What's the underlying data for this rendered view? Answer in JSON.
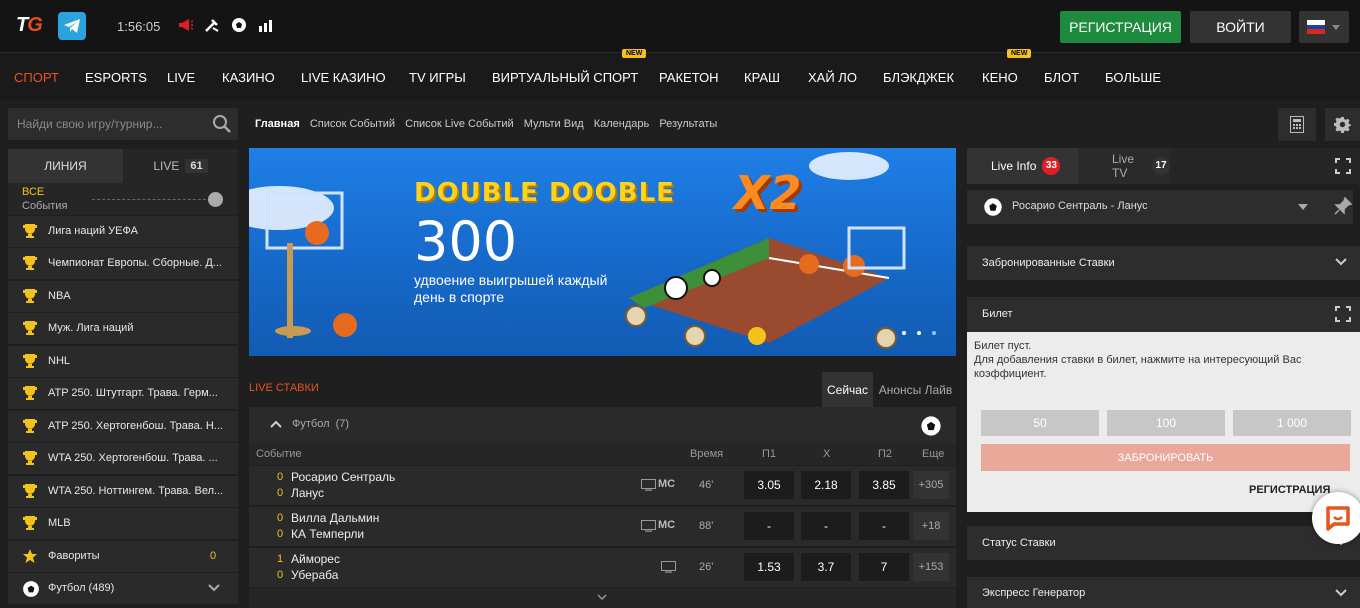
{
  "header": {
    "logo_t": "T",
    "logo_g": "G",
    "clock": "1:56:05",
    "register_label": "РЕГИСТРАЦИЯ",
    "login_label": "ВОЙТИ",
    "language": "ru"
  },
  "nav": {
    "items": [
      "СПОРТ",
      "ESPORTS",
      "LIVE",
      "КАЗИНО",
      "LIVE КАЗИНО",
      "TV ИГРЫ",
      "ВИРТУАЛЬНЫЙ СПОРТ",
      "РАКЕТОН",
      "КРАШ",
      "ХАЙ ЛО",
      "БЛЭКДЖЕК",
      "КЕНО",
      "БЛОТ",
      "БОЛЬШЕ"
    ],
    "new_badge": "NEW"
  },
  "search": {
    "placeholder": "Найди свою игру/турнир..."
  },
  "left_tabs": {
    "line": "ЛИНИЯ",
    "live": "LIVE",
    "live_count": "61"
  },
  "filter": {
    "all": "ВСЕ",
    "events": "События"
  },
  "left_list": [
    {
      "label": "Лига наций УЕФА",
      "icon": "trophy-icon"
    },
    {
      "label": "Чемпионат Европы. Сборные. Д...",
      "icon": "trophy-icon"
    },
    {
      "label": "NBA",
      "icon": "trophy-icon"
    },
    {
      "label": "Муж. Лига наций",
      "icon": "trophy-icon"
    },
    {
      "label": "NHL",
      "icon": "trophy-icon"
    },
    {
      "label": "ATP 250. Штутгарт. Трава. Герм...",
      "icon": "trophy-icon"
    },
    {
      "label": "ATP 250. Хертогенбош. Трава. Н...",
      "icon": "trophy-icon"
    },
    {
      "label": "WTA 250. Хертогенбош. Трава. ...",
      "icon": "trophy-icon"
    },
    {
      "label": "WTA 250. Ноттингем. Трава. Вел...",
      "icon": "trophy-icon"
    },
    {
      "label": "MLB",
      "icon": "trophy-icon"
    },
    {
      "label": "Фавориты",
      "icon": "star-icon",
      "count": "0"
    },
    {
      "label": "Футбол (489)",
      "icon": "soccer-ball-icon"
    }
  ],
  "breadcrumbs": [
    "Главная",
    "Список Событий",
    "Список Live Событий",
    "Мульти Вид",
    "Календарь",
    "Результаты"
  ],
  "banner": {
    "headline": "DOUBLE DOOBLE",
    "number": "300",
    "text": "удвоение выигрышей каждый день в спорте",
    "badge": "X2"
  },
  "live": {
    "section_label": "LIVE СТАВКИ",
    "tab_now": "Сейчас",
    "tab_announce": "Анонсы Лайв",
    "sport": "Футбол",
    "sport_count": "(7)",
    "columns": {
      "event": "Событие",
      "time": "Время",
      "p1": "П1",
      "x": "X",
      "p2": "П2",
      "more": "Еще"
    },
    "matches": [
      {
        "s1": "0",
        "t1": "Росарио Сентраль",
        "s2": "0",
        "t2": "Ланус",
        "tv": "MC",
        "time": "46'",
        "p1": "3.05",
        "x": "2.18",
        "p2": "3.85",
        "more": "+305"
      },
      {
        "s1": "0",
        "t1": "Вилла Дальмин",
        "s2": "0",
        "t2": "КА Темперли",
        "tv": "MC",
        "time": "88'",
        "p1": "-",
        "x": "-",
        "p2": "-",
        "more": "+18"
      },
      {
        "s1": "1",
        "t1": "Айморес",
        "s2": "0",
        "t2": "Убераба",
        "tv": "",
        "time": "26'",
        "p1": "1.53",
        "x": "3.7",
        "p2": "7",
        "more": "+153"
      }
    ]
  },
  "right": {
    "live_info": "Live Info",
    "live_info_count": "33",
    "live_tv": "Live TV",
    "live_tv_count": "17",
    "selected_match": "Росарио Сентраль - Ланус",
    "reserved_bets": "Забронированные Ставки",
    "ticket_title": "Билет",
    "ticket_empty": "Билет пуст.",
    "ticket_hint": "Для добавления ставки в билет, нажмите на интересующий Вас коэффициент.",
    "amounts": [
      "50",
      "100",
      "1 000"
    ],
    "book_label": "ЗАБРОНИРОВАТЬ",
    "register_label": "РЕГИСТРАЦИЯ",
    "bet_status": "Статус Ставки",
    "express": "Экспресс Генератор"
  },
  "colors": {
    "accent": "#e8541e",
    "register": "#1e8a3e",
    "gold": "#f4c21b",
    "live_badge": "#e31e24"
  }
}
